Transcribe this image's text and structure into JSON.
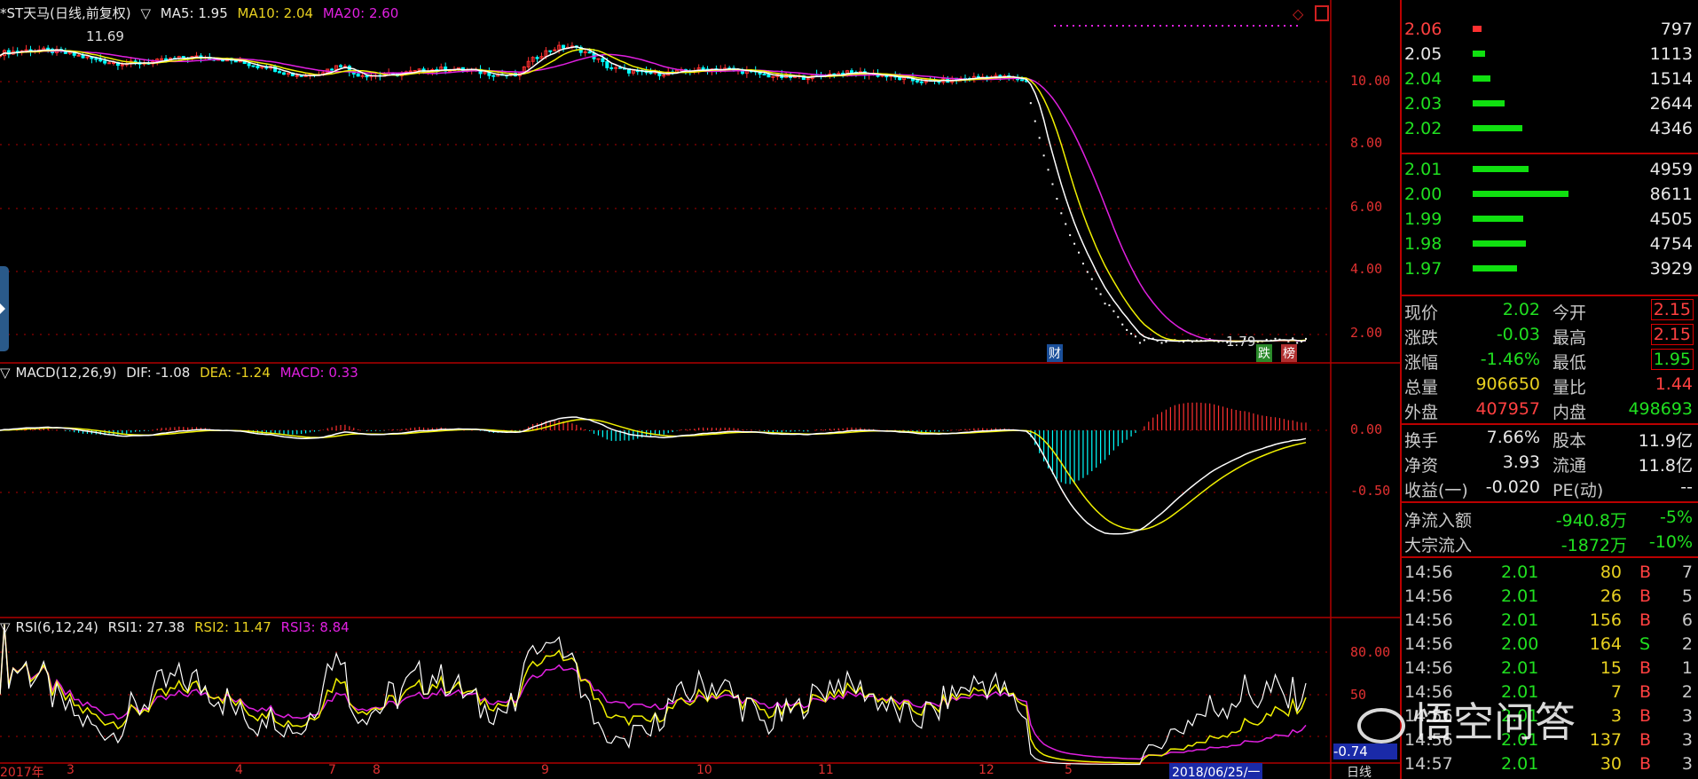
{
  "main": {
    "name": "*ST天马(日线,前复权)",
    "ma5": "MA5: 1.95",
    "ma10": "MA10: 2.04",
    "ma20": "MA20: 2.60",
    "high_label": "11.69",
    "low_label": "1.79",
    "yaxis": [
      "10.00",
      "8.00",
      "6.00",
      "4.00",
      "2.00"
    ],
    "tags": {
      "cai": "财",
      "die": "跌",
      "bang": "榜"
    }
  },
  "macd": {
    "label": "MACD(12,26,9)",
    "dif": "DIF: -1.08",
    "dea": "DEA: -1.24",
    "macd": "MACD: 0.33",
    "yaxis": [
      "0.00",
      "-0.50"
    ]
  },
  "rsi": {
    "label": "RSI(6,12,24)",
    "rsi1": "RSI1: 27.38",
    "rsi2": "RSI2: 11.47",
    "rsi3": "RSI3: 8.84",
    "yaxis": [
      "80.00",
      "50"
    ],
    "current": "-0.74"
  },
  "xaxis": {
    "year": "2017年",
    "months": [
      "3",
      "4",
      "7",
      "8",
      "9",
      "10",
      "11",
      "12",
      "5"
    ],
    "date": "2018/06/25/一",
    "period": "日线"
  },
  "order_book": {
    "asks": [
      {
        "price": "2.06",
        "vol": "797",
        "bar": 10
      },
      {
        "price": "2.05",
        "vol": "1113",
        "bar": 14
      },
      {
        "price": "2.04",
        "vol": "1514",
        "bar": 20
      },
      {
        "price": "2.03",
        "vol": "2644",
        "bar": 36
      },
      {
        "price": "2.02",
        "vol": "4346",
        "bar": 56
      }
    ],
    "bids": [
      {
        "price": "2.01",
        "vol": "4959",
        "bar": 63
      },
      {
        "price": "2.00",
        "vol": "8611",
        "bar": 108
      },
      {
        "price": "1.99",
        "vol": "4505",
        "bar": 57
      },
      {
        "price": "1.98",
        "vol": "4754",
        "bar": 60
      },
      {
        "price": "1.97",
        "vol": "3929",
        "bar": 50
      }
    ]
  },
  "quote": [
    {
      "k1": "现价",
      "v1": "2.02",
      "c1": "grn",
      "k2": "今开",
      "v2": "2.15",
      "c2": "red",
      "box2": true
    },
    {
      "k1": "涨跌",
      "v1": "-0.03",
      "c1": "grn",
      "k2": "最高",
      "v2": "2.15",
      "c2": "red",
      "box2": true
    },
    {
      "k1": "涨幅",
      "v1": "-1.46%",
      "c1": "grn",
      "k2": "最低",
      "v2": "1.95",
      "c2": "grn",
      "box2": true
    },
    {
      "k1": "总量",
      "v1": "906650",
      "c1": "yel",
      "k2": "量比",
      "v2": "1.44",
      "c2": "red",
      "box2": false
    },
    {
      "k1": "外盘",
      "v1": "407957",
      "c1": "red",
      "k2": "内盘",
      "v2": "498693",
      "c2": "grn",
      "box2": false
    }
  ],
  "fund": [
    {
      "k1": "换手",
      "v1": "7.66%",
      "k2": "股本",
      "v2": "11.9亿"
    },
    {
      "k1": "净资",
      "v1": "3.93",
      "k2": "流通",
      "v2": "11.8亿"
    },
    {
      "k1": "收益(一)",
      "v1": "-0.020",
      "k2": "PE(动)",
      "v2": "--"
    }
  ],
  "flow": [
    {
      "k": "净流入额",
      "v": "-940.8万",
      "p": "-5%"
    },
    {
      "k": "大宗流入",
      "v": "-1872万",
      "p": "-10%"
    }
  ],
  "ticks": [
    {
      "t": "14:56",
      "p": "2.01",
      "v": "80",
      "s": "B",
      "n": "7"
    },
    {
      "t": "14:56",
      "p": "2.01",
      "v": "26",
      "s": "B",
      "n": "5"
    },
    {
      "t": "14:56",
      "p": "2.01",
      "v": "156",
      "s": "B",
      "n": "6"
    },
    {
      "t": "14:56",
      "p": "2.00",
      "v": "164",
      "s": "S",
      "n": "2"
    },
    {
      "t": "14:56",
      "p": "2.01",
      "v": "15",
      "s": "B",
      "n": "1"
    },
    {
      "t": "14:56",
      "p": "2.01",
      "v": "7",
      "s": "B",
      "n": "2"
    },
    {
      "t": "14:56",
      "p": "2.01",
      "v": "3",
      "s": "B",
      "n": "3"
    },
    {
      "t": "14:56",
      "p": "2.01",
      "v": "137",
      "s": "B",
      "n": "3"
    },
    {
      "t": "14:57",
      "p": "2.01",
      "v": "30",
      "s": "B",
      "n": "3"
    }
  ],
  "watermark": "悟空问答",
  "colors": {
    "up": "#ff3030",
    "down": "#00ffff",
    "ma5": "#ffffff",
    "ma10": "#f0f000",
    "ma20": "#e020e0",
    "grid": "#b00000"
  }
}
